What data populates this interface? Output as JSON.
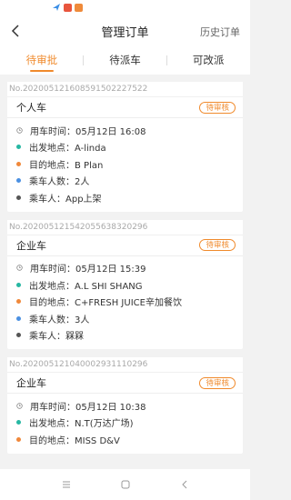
{
  "header": {
    "title": "管理订单",
    "history_label": "历史订单"
  },
  "tabs": [
    {
      "label": "待审批",
      "active": true
    },
    {
      "label": "待派车",
      "active": false
    },
    {
      "label": "可改派",
      "active": false
    }
  ],
  "colors": {
    "accent": "#f08a2c",
    "depart": "#26b7a2",
    "destination": "#f0883a",
    "passengers": "#4a90e2",
    "passenger": "#555555"
  },
  "orders": [
    {
      "order_no": "No.20200512160859150222752​2",
      "type": "个人车",
      "status": "待审核",
      "time": "用车时间：05月12日 16:08",
      "depart": "出发地点：A-linda",
      "destination": "目的地点：B Plan",
      "count": "乘车人数：2人",
      "passenger": "乘车人：App上架"
    },
    {
      "order_no": "No.20200512154205563832029​6",
      "type": "企业车",
      "status": "待审核",
      "time": "用车时间：05月12日 15:39",
      "depart": "出发地点：A.L SHI SHANG",
      "destination": "目的地点：C+FRESH JUICE辛加餐饮",
      "count": "乘车人数：3人",
      "passenger": "乘车人：槑槑"
    },
    {
      "order_no": "No.20200512104000293111029​6",
      "type": "企业车",
      "status": "待审核",
      "time": "用车时间：05月12日 10:38",
      "depart": "出发地点：N.T(万达广场)",
      "destination": "目的地点：MISS D&V"
    }
  ]
}
